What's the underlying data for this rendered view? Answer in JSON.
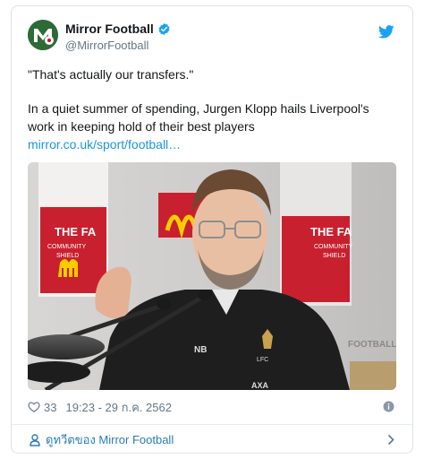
{
  "account": {
    "display_name": "Mirror Football",
    "handle": "@MirrorFootball",
    "verified": true
  },
  "tweet": {
    "quote": "\"That's actually our transfers.\"",
    "body": "In a quiet summer of spending, Jurgen Klopp hails Liverpool's work in keeping hold of their best players",
    "link": "mirror.co.uk/sport/football…"
  },
  "media": {
    "backdrop_texts": [
      "THE FA",
      "COMMUNITY",
      "SHIELD",
      "FOOTBALL"
    ],
    "shirt_texts": [
      "LFC",
      "AXA"
    ]
  },
  "meta": {
    "likes": "33",
    "timestamp": "19:23 - 29 ก.ค. 2562"
  },
  "footer": {
    "view_profile": "ดูทวีตของ Mirror Football"
  },
  "icons": {
    "bird": "twitter-bird-icon",
    "verified": "verified-badge-icon",
    "like": "heart-icon",
    "info": "info-icon",
    "profile": "person-icon",
    "chevron": "chevron-right-icon"
  },
  "colors": {
    "link": "#1b95e0",
    "brand_blue": "#1da1f2",
    "muted": "#657786",
    "footer_link": "#2b7bb9"
  }
}
